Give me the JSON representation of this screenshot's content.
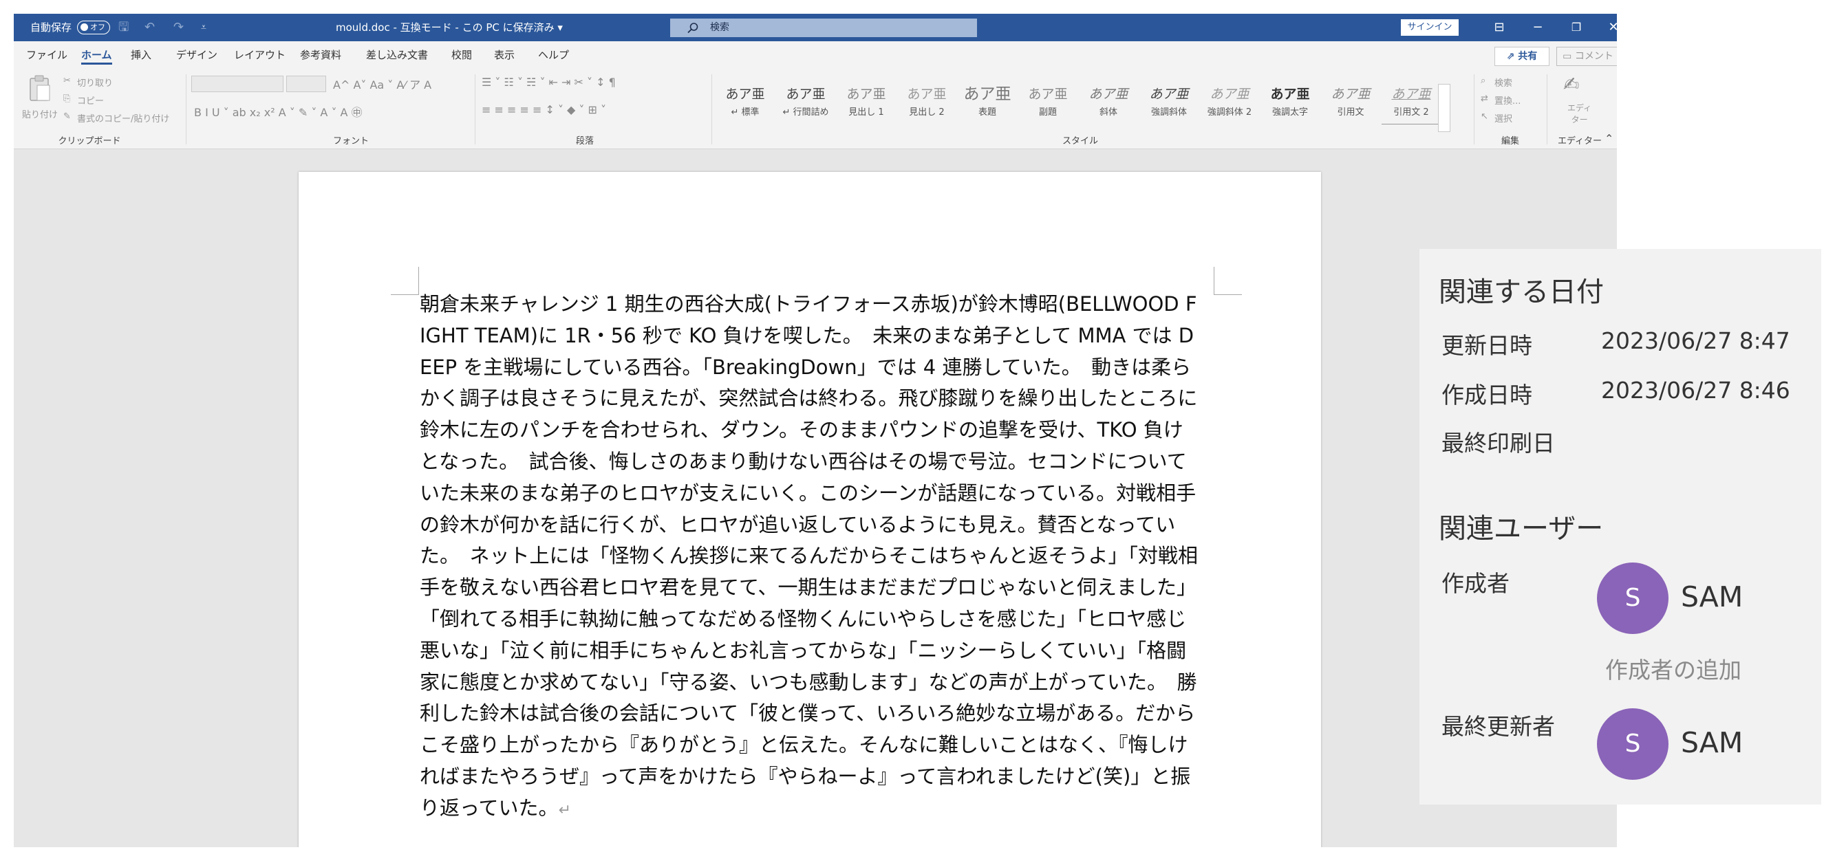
{
  "titlebar": {
    "autosave_label": "自動保存",
    "autosave_state": "オフ",
    "qat_save": "🖫",
    "qat_undo": "↶",
    "qat_redo": "↷",
    "qat_customize": "⩡",
    "document_title": "mould.doc - 互換モード - この PC に保存済み ▾",
    "search_placeholder": "検索",
    "signin_label": "サインイン",
    "ribbon_display_glyph": "⊟",
    "minimize_glyph": "−",
    "restore_glyph": "❐",
    "close_glyph": "✕"
  },
  "menu": {
    "tabs": [
      "ファイル",
      "ホーム",
      "挿入",
      "デザイン",
      "レイアウト",
      "参考資料",
      "差し込み文書",
      "校閲",
      "表示",
      "ヘルプ"
    ],
    "active_tab": "ホーム",
    "share_label": "共有",
    "comment_label": "コメント"
  },
  "ribbon": {
    "clipboard": {
      "paste_label": "貼り付け",
      "cut_label": "切り取り",
      "copy_label": "コピー",
      "format_painter_label": "書式のコピー/貼り付け",
      "group_label": "クリップボード"
    },
    "font": {
      "group_label": "フォント",
      "row1": "A^  A˅  Aa ˅  A⁄  ア  A",
      "row2": "B  I  U ˅  ab  x₂  x²  A ˅  ✎ ˅  A ˅  A  ㊥"
    },
    "paragraph": {
      "group_label": "段落",
      "row1": "☰ ˅  ☷ ˅  ☵ ˅  ⇤  ⇥  ✂ ˅  ↕  ¶",
      "row2": "≡  ≡  ≡  ≡  ≡  ↕ ˅  ◆ ˅  ⊞ ˅"
    },
    "styles": {
      "group_label": "スタイル",
      "items": [
        {
          "preview": "あア亜",
          "label": "↵ 標準"
        },
        {
          "preview": "あア亜",
          "label": "↵ 行間詰め"
        },
        {
          "preview": "あア亜",
          "label": "見出し 1"
        },
        {
          "preview": "あア亜",
          "label": "見出し 2"
        },
        {
          "preview": "あア亜",
          "label": "表題"
        },
        {
          "preview": "あア亜",
          "label": "副題"
        },
        {
          "preview": "あア亜",
          "label": "斜体"
        },
        {
          "preview": "あア亜",
          "label": "強調斜体"
        },
        {
          "preview": "あア亜",
          "label": "強調斜体 2"
        },
        {
          "preview": "あア亜",
          "label": "強調太字"
        },
        {
          "preview": "あア亜",
          "label": "引用文"
        },
        {
          "preview": "あア亜",
          "label": "引用文 2"
        }
      ]
    },
    "editing": {
      "group_label": "編集",
      "find_label": "検索",
      "replace_label": "置換...",
      "select_label": "選択"
    },
    "editor": {
      "group_label": "エディター",
      "button_label": "エディ\nター"
    },
    "collapse_glyph": "⌃"
  },
  "document": {
    "body": "朝倉未来チャレンジ 1 期生の西谷大成(トライフォース赤坂)が鈴木博昭(BELLWOOD FIGHT TEAM)に 1R・56 秒で KO 負けを喫した。　未来のまな弟子として MMA では DEEP を主戦場にしている西谷。「BreakingDown」では 4 連勝していた。　動きは柔らかく調子は良さそうに見えたが、突然試合は終わる。飛び膝蹴りを繰り出したところに鈴木に左のパンチを合わせられ、ダウン。そのままパウンドの追撃を受け、TKO 負けとなった。　試合後、悔しさのあまり動けない西谷はその場で号泣。セコンドについていた未来のまな弟子のヒロヤが支えにいく。このシーンが話題になっている。対戦相手の鈴木が何かを話に行くが、ヒロヤが追い返しているようにも見え。賛否となっていた。　ネット上には「怪物くん挨拶に来てるんだからそこはちゃんと返そうよ」「対戦相手を敬えない西谷君ヒロヤ君を見てて、一期生はまだまだプロじゃないと伺えました」「倒れてる相手に執拗に触ってなだめる怪物くんにいやらしさを感じた」「ヒロヤ感じ悪いな」「泣く前に相手にちゃんとお礼言ってからな」「ニッシーらしくていい」「格闘家に態度とか求めてない」「守る姿、いつも感動します」などの声が上がっていた。　勝利した鈴木は試合後の会話について「彼と僕って、いろいろ絶妙な立場がある。だからこそ盛り上がったから『ありがとう』と伝えた。そんなに難しいことはなく、『悔しければまたやろうぜ』って声をかけたら『やらねーよ』って言われましたけど(笑)」と振り返っていた。",
    "paragraph_mark": "↵"
  },
  "properties": {
    "dates_heading": "関連する日付",
    "modified_label": "更新日時",
    "modified_value": "2023/06/27 8:47",
    "created_label": "作成日時",
    "created_value": "2023/06/27 8:46",
    "printed_label": "最終印刷日",
    "users_heading": "関連ユーザー",
    "author_label": "作成者",
    "author_initial": "S",
    "author_name": "SAM",
    "add_author": "作成者の追加",
    "last_modified_by_label": "最終更新者",
    "last_modified_initial": "S",
    "last_modified_name": "SAM"
  },
  "colors": {
    "titlebar": "#2b579a",
    "avatar": "#8a64b8",
    "panel": "#f2f2f2"
  }
}
